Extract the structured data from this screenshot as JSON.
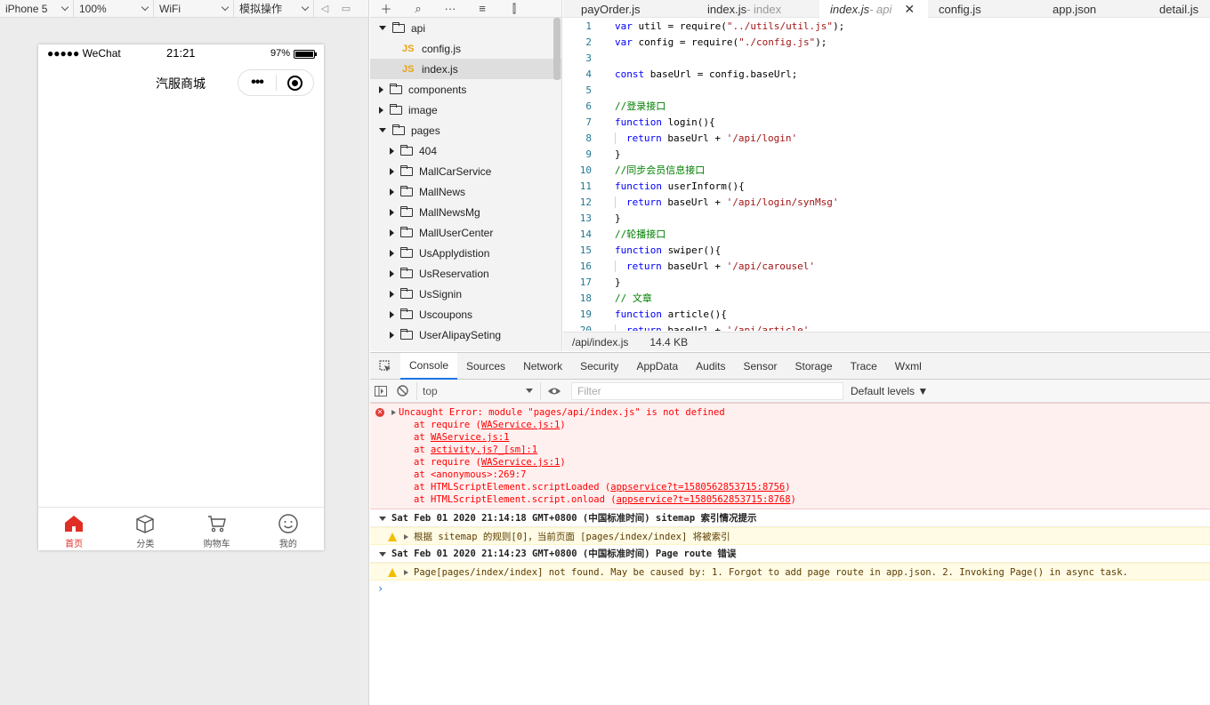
{
  "simulator": {
    "device": "iPhone 5",
    "zoom": "100%",
    "network": "WiFi",
    "operate": "模拟操作",
    "status_left": "●●●●● WeChat",
    "time": "21:21",
    "battery": "97%",
    "page_title": "汽服商城",
    "capsule_dots": "•••",
    "tabs": [
      {
        "label": "首页",
        "icon": "home-icon",
        "active": true
      },
      {
        "label": "分类",
        "icon": "box-icon",
        "active": false
      },
      {
        "label": "购物车",
        "icon": "cart-icon",
        "active": false
      },
      {
        "label": "我的",
        "icon": "smile-icon",
        "active": false
      }
    ],
    "accent": "#e02e24"
  },
  "tree": {
    "items": [
      {
        "label": "api",
        "type": "folder",
        "open": true,
        "level": 0
      },
      {
        "label": "config.js",
        "type": "js",
        "level": 1
      },
      {
        "label": "index.js",
        "type": "js",
        "level": 1,
        "selected": true
      },
      {
        "label": "components",
        "type": "folder",
        "open": false,
        "level": 0
      },
      {
        "label": "image",
        "type": "folder",
        "open": false,
        "level": 0
      },
      {
        "label": "pages",
        "type": "folder",
        "open": true,
        "level": 0
      },
      {
        "label": "404",
        "type": "folder",
        "open": false,
        "level": 1
      },
      {
        "label": "MallCarService",
        "type": "folder",
        "open": false,
        "level": 1
      },
      {
        "label": "MallNews",
        "type": "folder",
        "open": false,
        "level": 1
      },
      {
        "label": "MallNewsMg",
        "type": "folder",
        "open": false,
        "level": 1
      },
      {
        "label": "MallUserCenter",
        "type": "folder",
        "open": false,
        "level": 1
      },
      {
        "label": "UsApplydistion",
        "type": "folder",
        "open": false,
        "level": 1
      },
      {
        "label": "UsReservation",
        "type": "folder",
        "open": false,
        "level": 1
      },
      {
        "label": "UsSignin",
        "type": "folder",
        "open": false,
        "level": 1
      },
      {
        "label": "Uscoupons",
        "type": "folder",
        "open": false,
        "level": 1
      },
      {
        "label": "UserAlipaySeting",
        "type": "folder",
        "open": false,
        "level": 1
      }
    ],
    "js_badge": "JS"
  },
  "editor": {
    "tabs": [
      {
        "label": "payOrder.js",
        "sub": ""
      },
      {
        "label": "index.js",
        "sub": " - index"
      },
      {
        "label": "index.js",
        "sub": " - api",
        "active": true
      },
      {
        "label": "config.js",
        "sub": ""
      },
      {
        "label": "app.json",
        "sub": ""
      },
      {
        "label": "detail.js",
        "sub": ""
      }
    ],
    "close": "✕",
    "lines": [
      {
        "n": "1",
        "parts": [
          [
            "kw",
            "var"
          ],
          [
            "",
            " util = require("
          ],
          [
            "str",
            "\"../utils/util.js\""
          ],
          [
            "",
            ");"
          ]
        ]
      },
      {
        "n": "2",
        "parts": [
          [
            "kw",
            "var"
          ],
          [
            "",
            " config = require("
          ],
          [
            "str",
            "\"./config.js\""
          ],
          [
            "",
            ");"
          ]
        ]
      },
      {
        "n": "3",
        "parts": []
      },
      {
        "n": "4",
        "parts": [
          [
            "kw",
            "const"
          ],
          [
            "",
            " baseUrl = config.baseUrl;"
          ]
        ]
      },
      {
        "n": "5",
        "parts": []
      },
      {
        "n": "6",
        "parts": [
          [
            "cm",
            "//登录接口"
          ]
        ]
      },
      {
        "n": "7",
        "parts": [
          [
            "kw",
            "function"
          ],
          [
            "",
            " login(){"
          ]
        ]
      },
      {
        "n": "8",
        "indent": true,
        "parts": [
          [
            "kw",
            "return"
          ],
          [
            "",
            " baseUrl + "
          ],
          [
            "str",
            "'/api/login'"
          ]
        ]
      },
      {
        "n": "9",
        "parts": [
          [
            "",
            "}"
          ]
        ]
      },
      {
        "n": "10",
        "parts": [
          [
            "cm",
            "//同步会员信息接口"
          ]
        ]
      },
      {
        "n": "11",
        "parts": [
          [
            "kw",
            "function"
          ],
          [
            "",
            " userInform(){"
          ]
        ]
      },
      {
        "n": "12",
        "indent": true,
        "parts": [
          [
            "kw",
            "return"
          ],
          [
            "",
            " baseUrl + "
          ],
          [
            "str",
            "'/api/login/synMsg'"
          ]
        ]
      },
      {
        "n": "13",
        "parts": [
          [
            "",
            "}"
          ]
        ]
      },
      {
        "n": "14",
        "parts": [
          [
            "cm",
            "//轮播接口"
          ]
        ]
      },
      {
        "n": "15",
        "parts": [
          [
            "kw",
            "function"
          ],
          [
            "",
            " swiper(){"
          ]
        ]
      },
      {
        "n": "16",
        "indent": true,
        "parts": [
          [
            "kw",
            "return"
          ],
          [
            "",
            " baseUrl + "
          ],
          [
            "str",
            "'/api/carousel'"
          ]
        ]
      },
      {
        "n": "17",
        "parts": [
          [
            "",
            "}"
          ]
        ]
      },
      {
        "n": "18",
        "parts": [
          [
            "cm",
            "// 文章"
          ]
        ]
      },
      {
        "n": "19",
        "parts": [
          [
            "kw",
            "function"
          ],
          [
            "",
            " article(){"
          ]
        ]
      },
      {
        "n": "20",
        "indent": true,
        "parts": [
          [
            "kw",
            "return"
          ],
          [
            "",
            " baseUrl + "
          ],
          [
            "str",
            "'/api/article'"
          ]
        ]
      }
    ],
    "status_path": "/api/index.js",
    "status_size": "14.4 KB"
  },
  "devtools": {
    "tabs": [
      "Console",
      "Sources",
      "Network",
      "Security",
      "AppData",
      "Audits",
      "Sensor",
      "Storage",
      "Trace",
      "Wxml"
    ],
    "active_tab": "Console",
    "context": "top",
    "filter_placeholder": "Filter",
    "levels": "Default levels ▼",
    "error": {
      "head": "Uncaught Error: module \"pages/api/index.js\" is not defined",
      "stack": [
        {
          "pre": "at require (",
          "link": "WAService.js:1",
          "post": ")"
        },
        {
          "pre": "at ",
          "link": "WAService.js:1",
          "post": ""
        },
        {
          "pre": "at ",
          "link": "activity.js?_[sm]:1",
          "post": ""
        },
        {
          "pre": "at require (",
          "link": "WAService.js:1",
          "post": ")"
        },
        {
          "pre": "at <anonymous>:269:7",
          "link": "",
          "post": ""
        },
        {
          "pre": "at HTMLScriptElement.scriptLoaded (",
          "link": "appservice?t=1580562853715:8756",
          "post": ")"
        },
        {
          "pre": "at HTMLScriptElement.script.onload (",
          "link": "appservice?t=1580562853715:8768",
          "post": ")"
        }
      ]
    },
    "groups": [
      {
        "title": "Sat Feb 01 2020 21:14:18 GMT+0800 (中国标准时间) sitemap 索引情况提示",
        "warn": "根据 sitemap 的规则[0]，当前页面 [pages/index/index] 将被索引"
      },
      {
        "title": "Sat Feb 01 2020 21:14:23 GMT+0800 (中国标准时间) Page route 错误",
        "warn": "Page[pages/index/index] not found. May be caused by: 1. Forgot to add page route in app.json. 2. Invoking Page() in async task."
      }
    ],
    "prompt": "›"
  }
}
